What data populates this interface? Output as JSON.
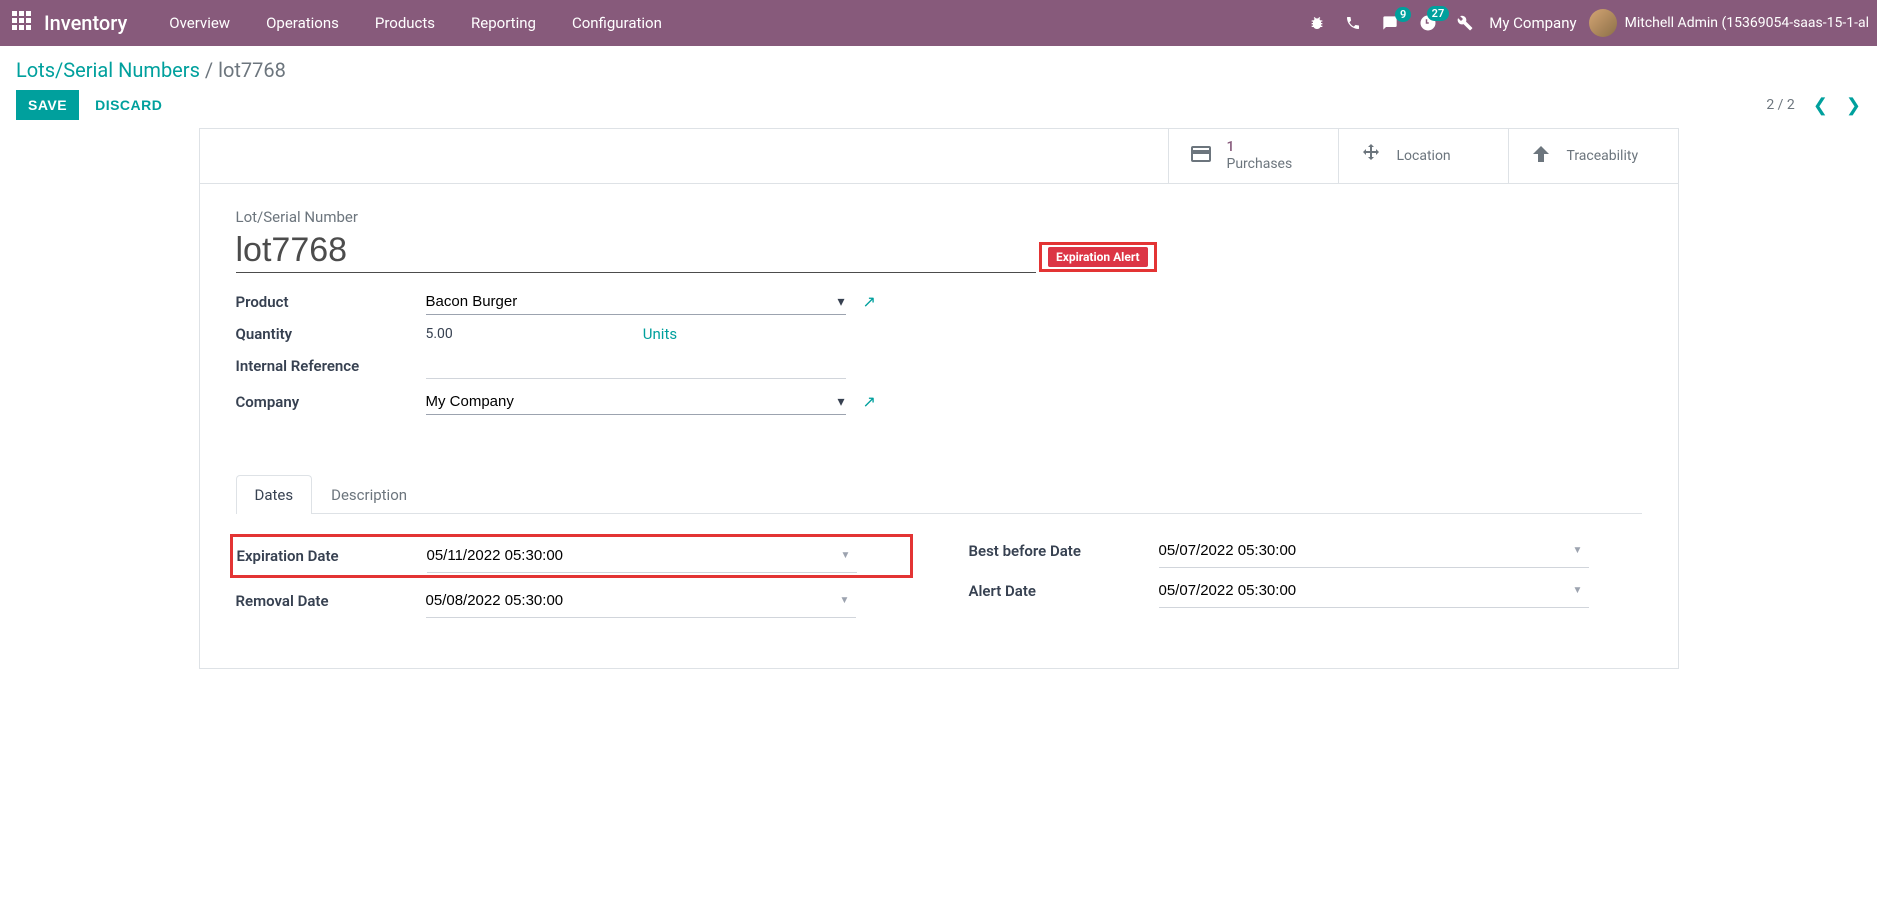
{
  "navbar": {
    "app_title": "Inventory",
    "menu": [
      "Overview",
      "Operations",
      "Products",
      "Reporting",
      "Configuration"
    ],
    "msg_badge": "9",
    "activity_badge": "27",
    "company": "My Company",
    "user": "Mitchell Admin (15369054-saas-15-1-al"
  },
  "breadcrumb": {
    "parent": "Lots/Serial Numbers",
    "current": "lot7768"
  },
  "buttons": {
    "save": "SAVE",
    "discard": "DISCARD"
  },
  "pager": "2 / 2",
  "stat": {
    "purchases_count": "1",
    "purchases_label": "Purchases",
    "location": "Location",
    "traceability": "Traceability"
  },
  "form": {
    "lot_label": "Lot/Serial Number",
    "lot_value": "lot7768",
    "alert_tag": "Expiration Alert",
    "product_label": "Product",
    "product_value": "Bacon Burger",
    "quantity_label": "Quantity",
    "quantity_value": "5.00",
    "quantity_units": "Units",
    "ref_label": "Internal Reference",
    "ref_value": "",
    "company_label": "Company",
    "company_value": "My Company"
  },
  "tabs": {
    "dates": "Dates",
    "description": "Description"
  },
  "dates": {
    "expiration_label": "Expiration Date",
    "expiration_value": "05/11/2022 05:30:00",
    "removal_label": "Removal Date",
    "removal_value": "05/08/2022 05:30:00",
    "best_before_label": "Best before Date",
    "best_before_value": "05/07/2022 05:30:00",
    "alert_label": "Alert Date",
    "alert_value": "05/07/2022 05:30:00"
  }
}
